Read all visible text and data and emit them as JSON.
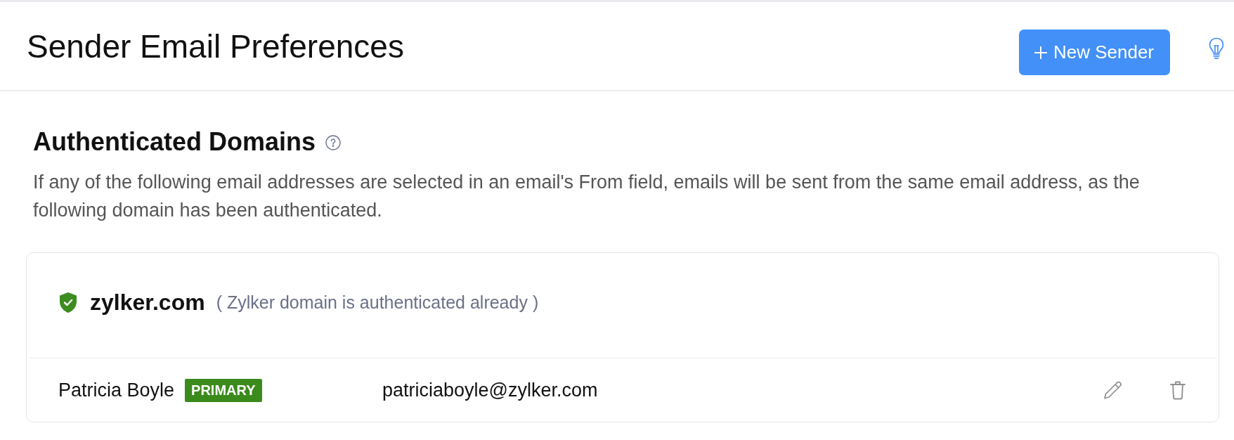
{
  "header": {
    "title": "Sender Email Preferences",
    "new_button": {
      "label": "New Sender"
    }
  },
  "section": {
    "heading": "Authenticated Domains",
    "description": "If any of the following email addresses are selected in an email's From field, emails will be sent from the same email address, as the following domain has been authenticated."
  },
  "domains": [
    {
      "domain": "zylker.com",
      "status_note": "( Zylker domain is authenticated already )",
      "senders": [
        {
          "name": "Patricia Boyle",
          "badge": "PRIMARY",
          "email": "patriciaboyle@zylker.com"
        }
      ]
    }
  ]
}
